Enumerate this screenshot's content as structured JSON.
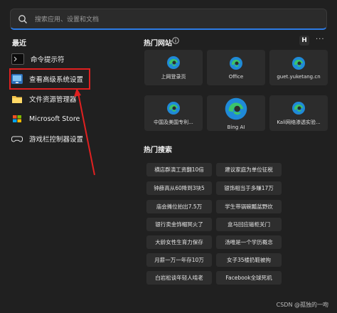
{
  "search": {
    "placeholder": "搜索应用、设置和文档"
  },
  "recent": {
    "title": "最近",
    "items": [
      {
        "label": "命令提示符",
        "icon": "cmd-icon"
      },
      {
        "label": "查看高级系统设置",
        "icon": "system-settings-icon"
      },
      {
        "label": "文件资源管理器",
        "icon": "folder-icon"
      },
      {
        "label": "Microsoft Store",
        "icon": "store-icon"
      },
      {
        "label": "游戏栏控制器设置",
        "icon": "gamebar-icon"
      }
    ]
  },
  "hot_sites": {
    "title": "热门网站",
    "badge": "H",
    "more": "···",
    "items": [
      {
        "label": "上网登录页"
      },
      {
        "label": "Office"
      },
      {
        "label": "guet.yuketang.cn"
      },
      {
        "label": "中国及美国专利..."
      },
      {
        "label": "Bing AI"
      },
      {
        "label": "Kali网络渗透实验..."
      }
    ]
  },
  "hot_search": {
    "title": "热门搜索",
    "items": [
      "横店群演工资翻10倍",
      "建议家庭为单位征税",
      "钟薛高从60降到3块5",
      "银饰相当于多赚17万",
      "庙会摊位拍出7.5万",
      "学生带锅碗瓢盆野炊",
      "银行卖金饰帽冥火了",
      "盒马回应磁柜关门",
      "大龄女性生育力保存",
      "汤唯是一个学历概念",
      "月薪一万一年存10万",
      "女子35楼扔鞋被拘",
      "白岩松谈年轻人啃老",
      "Facebook全球死机"
    ]
  },
  "watermark": "CSDN @孤独的一吻",
  "colors": {
    "accent": "#2c7be5",
    "highlight": "#e02020",
    "edge_blue": "#1f8ad8",
    "edge_green": "#3cc46a"
  }
}
